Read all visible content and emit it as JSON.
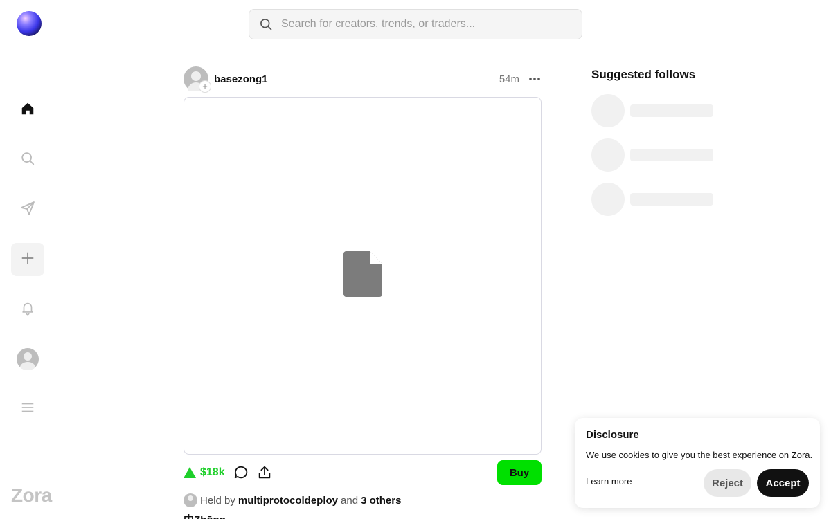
{
  "brand": {
    "wordmark": "Zora",
    "logo_icon": "zora-orb-icon"
  },
  "sidebar": {
    "items": [
      {
        "name": "home",
        "icon": "home-icon",
        "active": true
      },
      {
        "name": "search",
        "icon": "search-icon"
      },
      {
        "name": "messages",
        "icon": "send-icon"
      },
      {
        "name": "create",
        "icon": "plus-icon"
      },
      {
        "name": "notifications",
        "icon": "bell-icon"
      },
      {
        "name": "profile",
        "icon": "avatar-icon"
      },
      {
        "name": "menu",
        "icon": "menu-icon"
      }
    ]
  },
  "search": {
    "placeholder": "Search for creators, trends, or traders..."
  },
  "post": {
    "username": "basezong1",
    "time": "54m",
    "media_icon": "file-icon",
    "price": "$18k",
    "price_color": "#1fcf2b",
    "buy_label": "Buy",
    "buy_color": "#00e000",
    "held_prefix": "Held by",
    "held_by_user": "multiprotocoldeploy",
    "held_and": "and",
    "held_others": "3 others",
    "caption": "中Zhōng"
  },
  "suggested": {
    "title": "Suggested follows",
    "loading_rows": 3
  },
  "cookie": {
    "title": "Disclosure",
    "message": "We use cookies to give you the best experience on Zora.",
    "learn_more": "Learn more",
    "reject_label": "Reject",
    "accept_label": "Accept"
  }
}
